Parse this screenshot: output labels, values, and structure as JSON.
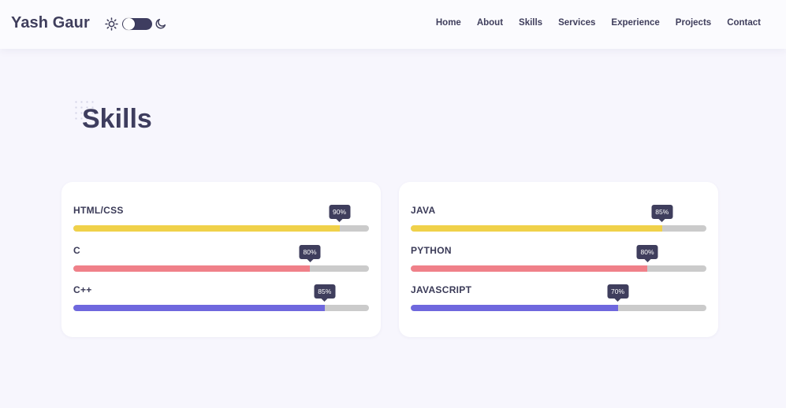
{
  "header": {
    "brand": "Yash Gaur",
    "theme_icons": {
      "light": "sun-icon",
      "dark": "moon-icon"
    },
    "nav": [
      "Home",
      "About",
      "Skills",
      "Services",
      "Experience",
      "Projects",
      "Contact"
    ]
  },
  "section": {
    "title": "Skills"
  },
  "skills": {
    "left": [
      {
        "name": "HTML/CSS",
        "percent": 90,
        "label": "90%",
        "color": "#f0d14a"
      },
      {
        "name": "C",
        "percent": 80,
        "label": "80%",
        "color": "#f08089"
      },
      {
        "name": "C++",
        "percent": 85,
        "label": "85%",
        "color": "#6f68de"
      }
    ],
    "right": [
      {
        "name": "JAVA",
        "percent": 85,
        "label": "85%",
        "color": "#f0d14a"
      },
      {
        "name": "PYTHON",
        "percent": 80,
        "label": "80%",
        "color": "#f08089"
      },
      {
        "name": "JAVASCRIPT",
        "percent": 70,
        "label": "70%",
        "color": "#6f68de"
      }
    ]
  }
}
